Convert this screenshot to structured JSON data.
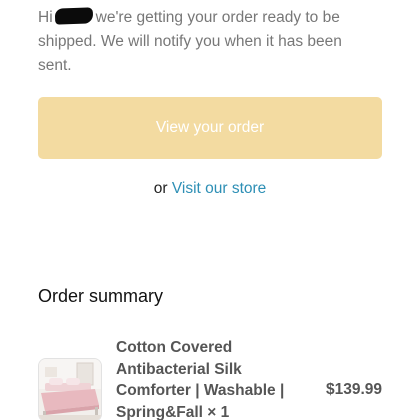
{
  "greeting": {
    "prefix": "Hi",
    "message": "we're getting your order ready to be shipped. We will notify you when it has been sent."
  },
  "actions": {
    "view_order_label": "View your order",
    "or_label": "or",
    "visit_store_label": "Visit our store"
  },
  "summary": {
    "title": "Order summary",
    "items": [
      {
        "name": "Cotton Covered Antibacterial Silk Comforter | Washable | Spring&Fall",
        "quantity": "× 1",
        "price": "$139.99",
        "thumbnail": "product-photo-bedroom"
      }
    ]
  },
  "colors": {
    "button_bg": "#f3dba1",
    "link": "#2d8fb5",
    "body_text": "#777777"
  }
}
